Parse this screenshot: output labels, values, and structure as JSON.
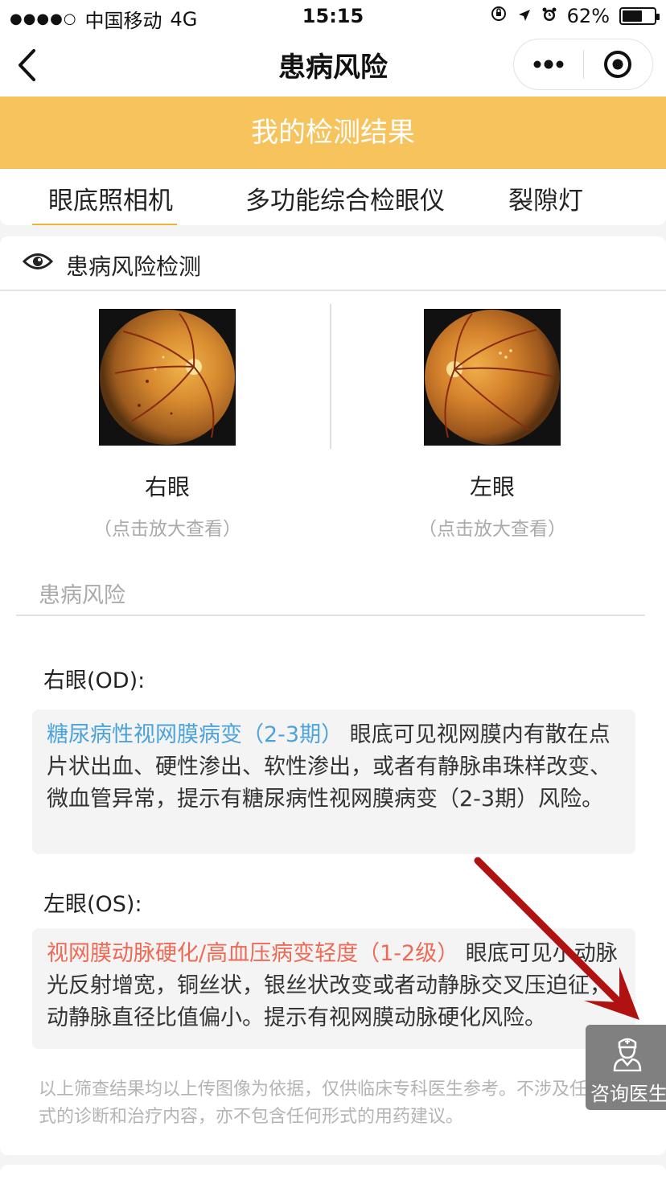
{
  "status_bar": {
    "signal": "●●●●○",
    "carrier": "中国移动",
    "network": "4G",
    "time": "15:15",
    "battery": "62%",
    "battery_level": 0.62
  },
  "nav": {
    "title": "患病风险",
    "more_icon": "ellipsis-icon",
    "target_icon": "target-icon",
    "back_icon": "chevron-left-icon"
  },
  "banner": {
    "title": "我的检测结果"
  },
  "tabs": [
    {
      "label": "眼底照相机",
      "active": true
    },
    {
      "label": "多功能综合检眼仪",
      "active": false
    },
    {
      "label": "裂隙灯",
      "active": false
    }
  ],
  "card": {
    "header_title": "患病风险检测",
    "right_eye": {
      "name": "右眼",
      "hint": "（点击放大查看）"
    },
    "left_eye": {
      "name": "左眼",
      "hint": "（点击放大查看）"
    },
    "section_label": "患病风险",
    "od": {
      "label": "右眼(OD):",
      "highlight": "糖尿病性视网膜病变（2-3期）",
      "text": "  眼底可见视网膜内有散在点片状出血、硬性渗出、软性渗出，或者有静脉串珠样改变、微血管异常，提示有糖尿病性视网膜病变（2-3期）风险。"
    },
    "os": {
      "label": "左眼(OS):",
      "highlight": "视网膜动脉硬化/高血压病变轻度（1-2级）",
      "text": "  眼底可见小动脉光反射增宽，铜丝状，银丝状改变或者动静脉交叉压迫征，动静脉直径比值偏小。提示有视网膜动脉硬化风险。"
    },
    "disclaimer": "以上筛查结果均以上传图像为依据，仅供临床专科医生参考。不涉及任何形式的诊断和治疗内容，亦不包含任何形式的用药建议。"
  },
  "consult": {
    "label": "咨询医生",
    "icon": "doctor-icon"
  },
  "colors": {
    "banner": "#f7c35c",
    "tab_underline": "#f0b03c",
    "od_highlight": "#4ca3dc",
    "os_highlight": "#ee6a55",
    "arrow": "#b01212"
  }
}
